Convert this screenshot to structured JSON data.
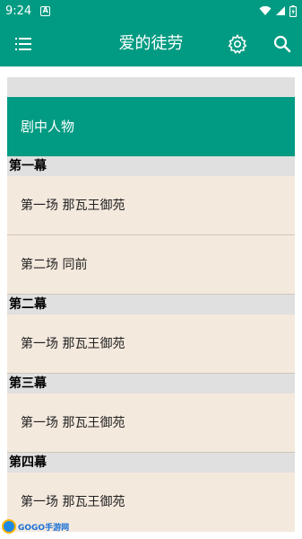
{
  "status_bar": {
    "time": "9:24",
    "notification_badge": "A"
  },
  "app_bar": {
    "title": "爱的徒劳",
    "menu_icon": "menu-icon",
    "settings_icon": "gear-icon",
    "search_icon": "search-icon"
  },
  "cast": {
    "label": "剧中人物"
  },
  "acts": [
    {
      "title": "第一幕",
      "scenes": [
        "第一场 那瓦王御苑",
        "第二场 同前"
      ]
    },
    {
      "title": "第二幕",
      "scenes": [
        "第一场 那瓦王御苑"
      ]
    },
    {
      "title": "第三幕",
      "scenes": [
        "第一场 那瓦王御苑"
      ]
    },
    {
      "title": "第四幕",
      "scenes": [
        "第一场 那瓦王御苑"
      ]
    }
  ],
  "watermark": {
    "text": "GOGO手游网"
  },
  "colors": {
    "primary": "#009b82",
    "scene_bg": "#f4e9dd",
    "header_bg": "#e0e0e0"
  }
}
